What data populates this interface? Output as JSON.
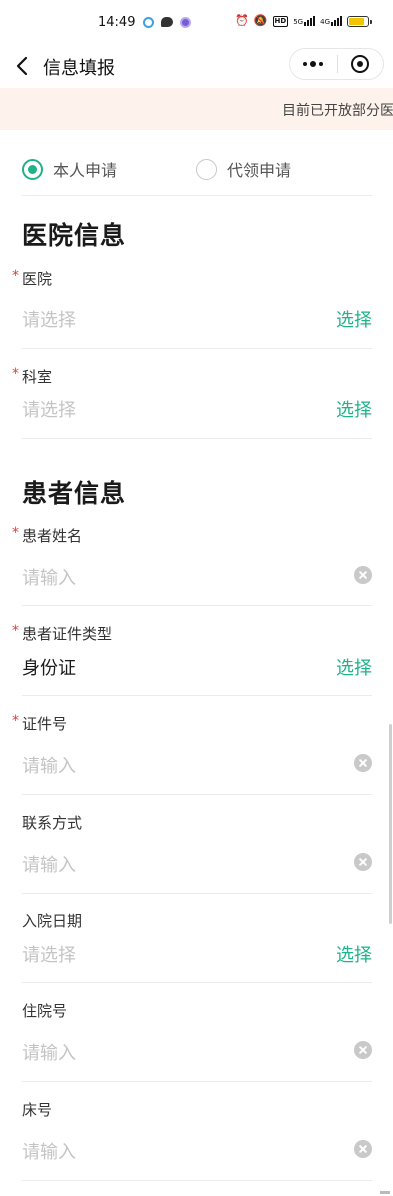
{
  "status_bar": {
    "time": "14:49",
    "network": "5G",
    "network2": "4G",
    "hd": "HD",
    "battery_level": 0.85,
    "battery_color": "#f3c500",
    "icons": [
      "alarm-icon",
      "mute-icon",
      "signal-icon",
      "battery-icon"
    ]
  },
  "nav": {
    "title": "信息填报",
    "back_icon": "chevron-left-icon",
    "more_icon": "more-dots-icon",
    "close_icon": "close-circle-icon"
  },
  "notice": {
    "text": "目前已开放部分医"
  },
  "apply_type": {
    "options": [
      {
        "label": "本人申请",
        "selected": true
      },
      {
        "label": "代领申请",
        "selected": false
      }
    ],
    "accent": "#1eb38a"
  },
  "hospital_section": {
    "title": "医院信息",
    "fields": [
      {
        "label": "医院",
        "required": true,
        "placeholder": "请选择",
        "action": "选择"
      },
      {
        "label": "科室",
        "required": true,
        "placeholder": "请选择",
        "action": "选择"
      }
    ]
  },
  "patient_section": {
    "title": "患者信息",
    "fields": [
      {
        "label": "患者姓名",
        "required": true,
        "placeholder": "请输入"
      },
      {
        "label": "患者证件类型",
        "required": true,
        "value": "身份证",
        "action": "选择"
      },
      {
        "label": "证件号",
        "required": true,
        "placeholder": "请输入"
      },
      {
        "label": "联系方式",
        "required": false,
        "placeholder": "请输入"
      },
      {
        "label": "入院日期",
        "required": false,
        "placeholder": "请选择",
        "action": "选择"
      },
      {
        "label": "住院号",
        "required": false,
        "placeholder": "请输入"
      },
      {
        "label": "床号",
        "required": false,
        "placeholder": "请输入"
      }
    ]
  },
  "required_mark": "*"
}
